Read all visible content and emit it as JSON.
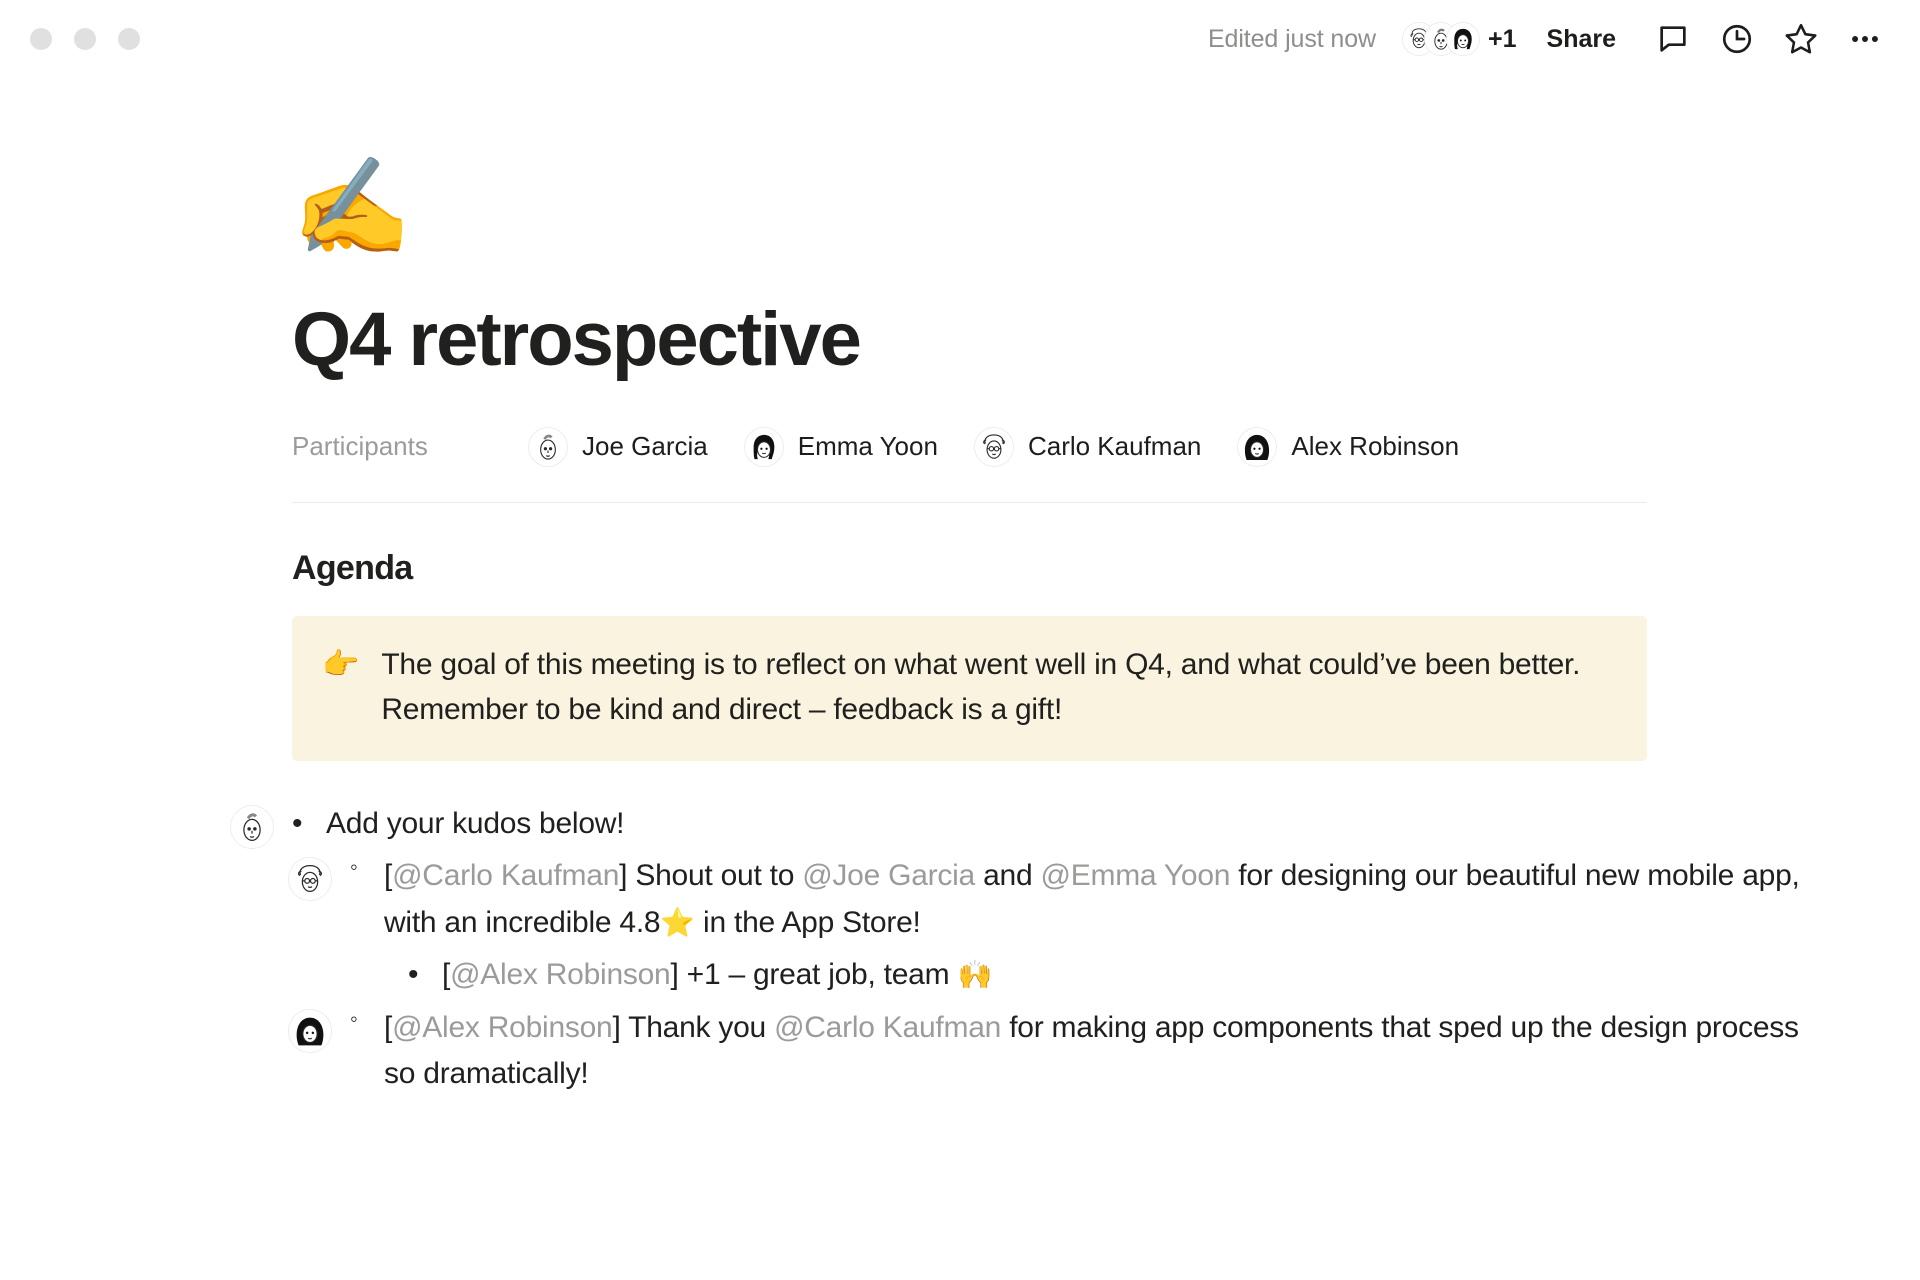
{
  "window": {
    "traffic_lights": [
      "close",
      "minimize",
      "maximize"
    ]
  },
  "header": {
    "edited_label": "Edited just now",
    "avatar_overflow": "+1",
    "share_label": "Share",
    "icons": [
      "comment-icon",
      "history-icon",
      "star-icon",
      "more-options-icon"
    ]
  },
  "document": {
    "page_emoji": "✍️",
    "title": "Q4 retrospective",
    "participants_label": "Participants",
    "participants": [
      {
        "name": "Joe Garcia",
        "avatar": "joe"
      },
      {
        "name": "Emma Yoon",
        "avatar": "emma"
      },
      {
        "name": "Carlo Kaufman",
        "avatar": "carlo"
      },
      {
        "name": "Alex Robinson",
        "avatar": "alex"
      }
    ],
    "agenda_heading": "Agenda",
    "callout": {
      "emoji": "👉",
      "text": "The goal of this meeting is to reflect on what went well in Q4, and what could’ve been better. Remember to be kind and direct – feedback is a gift!"
    },
    "bullets": {
      "b1": {
        "bullet": "•",
        "text": "Add your kudos below!"
      },
      "b2": {
        "bullet": "◦",
        "open_bracket": "[",
        "author": "@Carlo Kaufman",
        "close_bracket": "]",
        "seg1": " Shout out to ",
        "mention1": "@Joe Garcia",
        "seg2": " and ",
        "mention2": "@Emma Yoon",
        "seg3": " for designing our beautiful new mobile app, with an incredible 4.8",
        "emoji": "⭐",
        "seg4": " in the App Store!"
      },
      "b3": {
        "bullet": "•",
        "open_bracket": "[",
        "author": "@Alex Robinson",
        "close_bracket": "]",
        "seg1": " +1 – great job, team ",
        "emoji": "🙌"
      },
      "b4": {
        "bullet": "◦",
        "open_bracket": "[",
        "author": "@Alex Robinson",
        "close_bracket": "]",
        "seg1": " Thank you ",
        "mention1": "@Carlo Kaufman",
        "seg2": " for making app components that sped up the design process so dramatically!"
      }
    }
  },
  "colors": {
    "callout_bg": "#faf3e0",
    "mention_gray": "#9b9b99",
    "text": "#20201e",
    "muted": "#8e8e8c",
    "divider": "#ebebeb"
  }
}
